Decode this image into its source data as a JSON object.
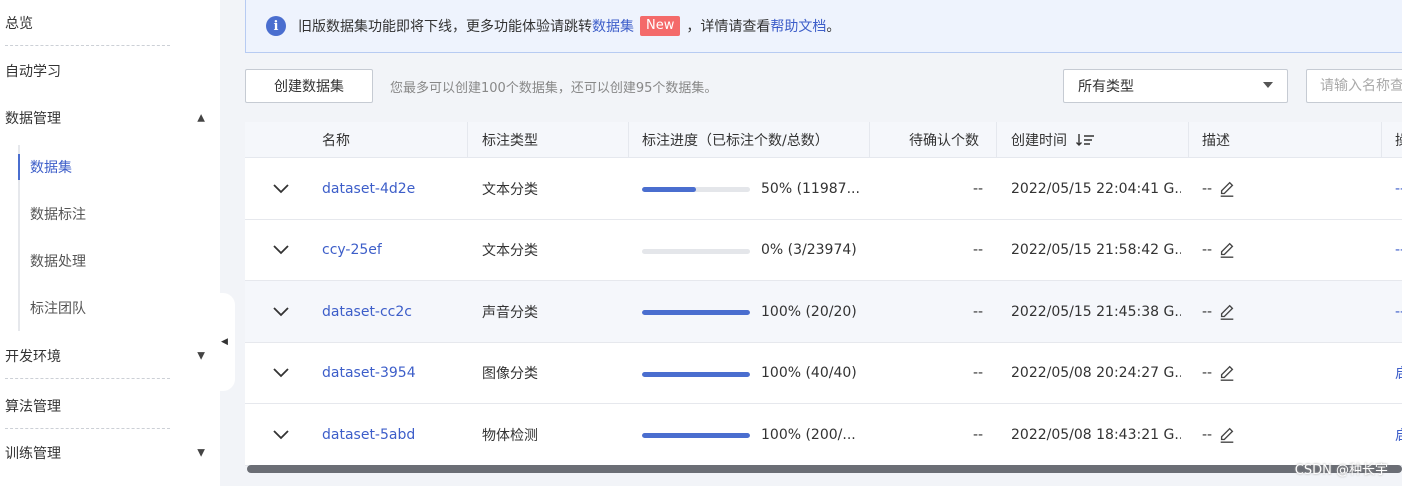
{
  "sidebar": {
    "items": [
      {
        "label": "总览"
      },
      {
        "label": "自动学习"
      },
      {
        "label": "数据管理"
      },
      {
        "label": "开发环境"
      },
      {
        "label": "算法管理"
      },
      {
        "label": "训练管理"
      }
    ],
    "sub_items": [
      {
        "label": "数据集",
        "active": true
      },
      {
        "label": "数据标注"
      },
      {
        "label": "数据处理"
      },
      {
        "label": "标注团队"
      }
    ]
  },
  "notice": {
    "text_before": "旧版数据集功能即将下线，更多功能体验请跳转",
    "link1": "数据集",
    "badge": "New",
    "text_middle": "，详情请查看",
    "link2": "帮助文档",
    "text_after": "。"
  },
  "toolbar": {
    "create_label": "创建数据集",
    "limit_text": "您最多可以创建100个数据集，还可以创建95个数据集。",
    "type_select_value": "所有类型",
    "search_placeholder": "请输入名称查"
  },
  "table": {
    "headers": {
      "name": "名称",
      "label_type": "标注类型",
      "progress": "标注进度（已标注个数/总数）",
      "pending": "待确认个数",
      "created": "创建时间",
      "desc": "描述",
      "extra": "操"
    },
    "rows": [
      {
        "name": "dataset-4d2e",
        "type": "文本分类",
        "progress_pct": 50,
        "progress_text": "50% (11987...",
        "pending": "--",
        "created": "2022/05/15 22:04:41 G...",
        "desc": "--",
        "extra": "--"
      },
      {
        "name": "ccy-25ef",
        "type": "文本分类",
        "progress_pct": 0,
        "progress_text": "0% (3/23974)",
        "pending": "--",
        "created": "2022/05/15 21:58:42 G...",
        "desc": "--",
        "extra": "--"
      },
      {
        "name": "dataset-cc2c",
        "type": "声音分类",
        "progress_pct": 100,
        "progress_text": "100% (20/20)",
        "pending": "--",
        "created": "2022/05/15 21:45:38 G...",
        "desc": "--",
        "extra": "--"
      },
      {
        "name": "dataset-3954",
        "type": "图像分类",
        "progress_pct": 100,
        "progress_text": "100% (40/40)",
        "pending": "--",
        "created": "2022/05/08 20:24:27 G...",
        "desc": "--",
        "extra": "启"
      },
      {
        "name": "dataset-5abd",
        "type": "物体检测",
        "progress_pct": 100,
        "progress_text": "100% (200/...",
        "pending": "--",
        "created": "2022/05/08 18:43:21 G...",
        "desc": "--",
        "extra": "启"
      }
    ]
  },
  "watermark": "CSDN @种长宇",
  "colors": {
    "accent": "#4a6ecf",
    "badge": "#f46a6a"
  }
}
